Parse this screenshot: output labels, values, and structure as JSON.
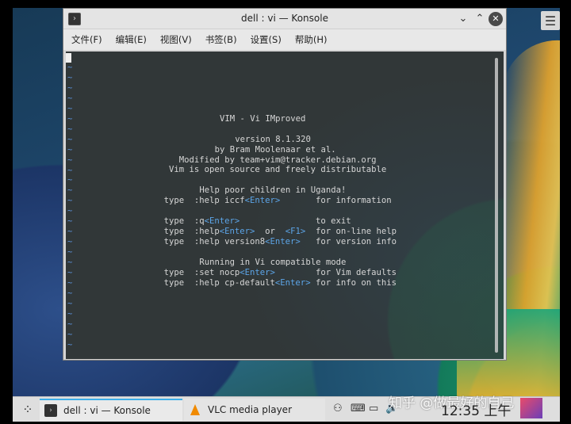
{
  "window": {
    "title": "dell : vi — Konsole",
    "menu": [
      "文件(F)",
      "编辑(E)",
      "视图(V)",
      "书签(B)",
      "设置(S)",
      "帮助(H)"
    ]
  },
  "terminal": {
    "tilde": "~",
    "lines": [
      {
        "row": 6,
        "col": 30,
        "segments": [
          {
            "text": "VIM - Vi IMproved"
          }
        ]
      },
      {
        "row": 8,
        "col": 33,
        "segments": [
          {
            "text": "version 8.1.320"
          }
        ]
      },
      {
        "row": 9,
        "col": 29,
        "segments": [
          {
            "text": "by Bram Moolenaar et al."
          }
        ]
      },
      {
        "row": 10,
        "col": 22,
        "segments": [
          {
            "text": "Modified by team+vim@tracker.debian.org"
          }
        ]
      },
      {
        "row": 11,
        "col": 20,
        "segments": [
          {
            "text": "Vim is open source and freely distributable"
          }
        ]
      },
      {
        "row": 13,
        "col": 26,
        "segments": [
          {
            "text": "Help poor children in Uganda!"
          }
        ]
      },
      {
        "row": 14,
        "col": 19,
        "segments": [
          {
            "text": "type  :help iccf"
          },
          {
            "text": "<Enter>",
            "kw": true
          },
          {
            "text": "       for information"
          }
        ]
      },
      {
        "row": 16,
        "col": 19,
        "segments": [
          {
            "text": "type  :q"
          },
          {
            "text": "<Enter>",
            "kw": true
          },
          {
            "text": "               to exit"
          }
        ]
      },
      {
        "row": 17,
        "col": 19,
        "segments": [
          {
            "text": "type  :help"
          },
          {
            "text": "<Enter>",
            "kw": true
          },
          {
            "text": "  or  "
          },
          {
            "text": "<F1>",
            "kw": true
          },
          {
            "text": "  for on-line help"
          }
        ]
      },
      {
        "row": 18,
        "col": 19,
        "segments": [
          {
            "text": "type  :help version8"
          },
          {
            "text": "<Enter>",
            "kw": true
          },
          {
            "text": "   for version info"
          }
        ]
      },
      {
        "row": 20,
        "col": 26,
        "segments": [
          {
            "text": "Running in Vi compatible mode"
          }
        ]
      },
      {
        "row": 21,
        "col": 19,
        "segments": [
          {
            "text": "type  :set nocp"
          },
          {
            "text": "<Enter>",
            "kw": true
          },
          {
            "text": "        for Vim defaults"
          }
        ]
      },
      {
        "row": 22,
        "col": 19,
        "segments": [
          {
            "text": "type  :help cp-default"
          },
          {
            "text": "<Enter>",
            "kw": true
          },
          {
            "text": " for info on this"
          }
        ]
      }
    ]
  },
  "taskbar": {
    "tasks": [
      {
        "label": "dell : vi — Konsole",
        "icon": "terminal-icon",
        "active": true
      },
      {
        "label": "VLC media player",
        "icon": "vlc-icon",
        "active": false
      }
    ],
    "clock": "12:35 上午",
    "watermark": "知乎 @做最好的自己"
  },
  "colors": {
    "accent": "#3daee9",
    "vim_keyword": "#5ca5e8",
    "tilde": "#5a8fd6"
  }
}
